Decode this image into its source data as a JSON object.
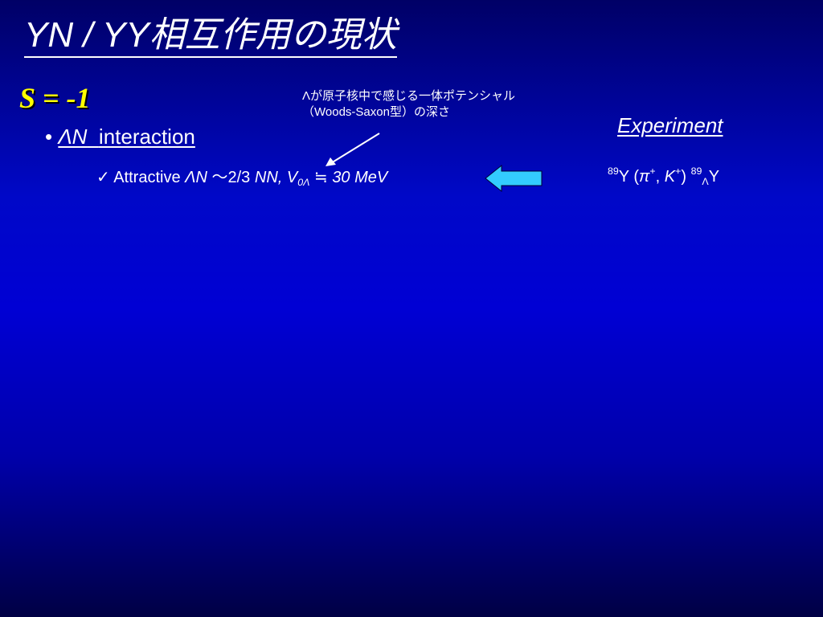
{
  "slide": {
    "title": "YN / YY相互作用の現状",
    "subtitle": "S = -1"
  },
  "bullet": {
    "marker": "•",
    "symbol": "ΛN",
    "text": "interaction"
  },
  "attractive_line": {
    "check": "✓",
    "word": "Attractive",
    "lambda_n": "ΛN",
    "approx": "〜2/3",
    "nn": "NN,",
    "v": "V",
    "v_sub": "0Λ",
    "approx_eq": "≒",
    "value": "30 MeV"
  },
  "annotation": {
    "line1": "Λが原子核中で感じる一体ポテンシャル",
    "line2": "（Woods-Saxon型）の深さ"
  },
  "experiment": {
    "heading": "Experiment",
    "mass_number": "89",
    "target": "Y",
    "open_paren": "(",
    "pi": "π",
    "pi_charge": "+",
    "comma": ",",
    "kaon": "K",
    "kaon_charge": "+",
    "close_paren": ")",
    "product_mass": "89",
    "product_sub": "Λ",
    "product": "Y"
  },
  "colors": {
    "subtitle": "#ffff00",
    "block_arrow": "#33ccff",
    "text": "#ffffff"
  },
  "icons": {
    "pointer_arrow": "thin-arrow-icon",
    "block_arrow": "left-block-arrow-icon"
  }
}
